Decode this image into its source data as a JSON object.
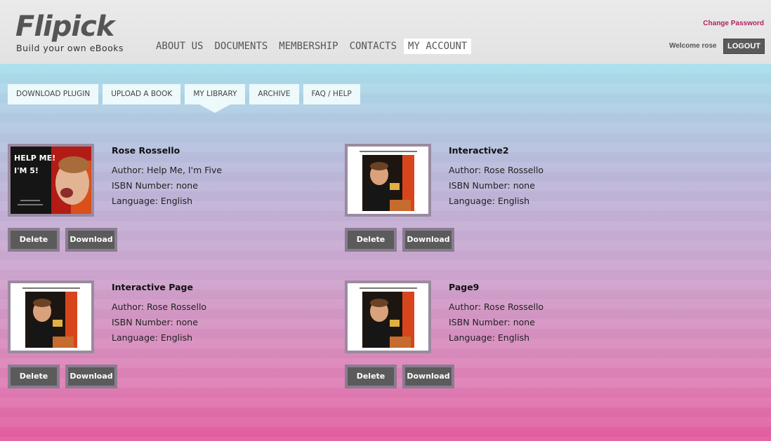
{
  "brand": {
    "logo": "Flipick",
    "tagline": "Build your own eBooks"
  },
  "nav": [
    {
      "label": "ABOUT US",
      "active": false
    },
    {
      "label": "DOCUMENTS",
      "active": false
    },
    {
      "label": "MEMBERSHIP",
      "active": false
    },
    {
      "label": "CONTACTS",
      "active": false
    },
    {
      "label": "MY ACCOUNT",
      "active": true
    }
  ],
  "account": {
    "change_password": "Change Password",
    "welcome": "Welcome rose",
    "logout": "LOGOUT"
  },
  "subnav": [
    {
      "label": "DOWNLOAD PLUGIN",
      "active": false
    },
    {
      "label": "UPLOAD A BOOK",
      "active": false
    },
    {
      "label": "MY LIBRARY",
      "active": true
    },
    {
      "label": "ARCHIVE",
      "active": false
    },
    {
      "label": "FAQ / HELP",
      "active": false
    }
  ],
  "books": [
    {
      "title": "Rose Rossello",
      "author": "Author: Help Me, I'm Five",
      "isbn": "ISBN Number: none",
      "language": "Language: English",
      "thumbnail": "cover",
      "cover_text": "HELP ME! I'M 5!",
      "delete_label": "Delete",
      "download_label": "Download"
    },
    {
      "title": "Interactive2",
      "author": "Author: Rose Rossello",
      "isbn": "ISBN Number: none",
      "language": "Language: English",
      "thumbnail": "page",
      "delete_label": "Delete",
      "download_label": "Download"
    },
    {
      "title": "Interactive Page",
      "author": "Author: Rose Rossello",
      "isbn": "ISBN Number: none",
      "language": "Language: English",
      "thumbnail": "page",
      "delete_label": "Delete",
      "download_label": "Download"
    },
    {
      "title": "Page9",
      "author": "Author: Rose Rossello",
      "isbn": "ISBN Number: none",
      "language": "Language: English",
      "thumbnail": "page",
      "delete_label": "Delete",
      "download_label": "Download"
    }
  ],
  "colors": {
    "accent": "#b0235c",
    "button_dark": "#5b5b5b",
    "tab_bg": "#eef9fb"
  }
}
